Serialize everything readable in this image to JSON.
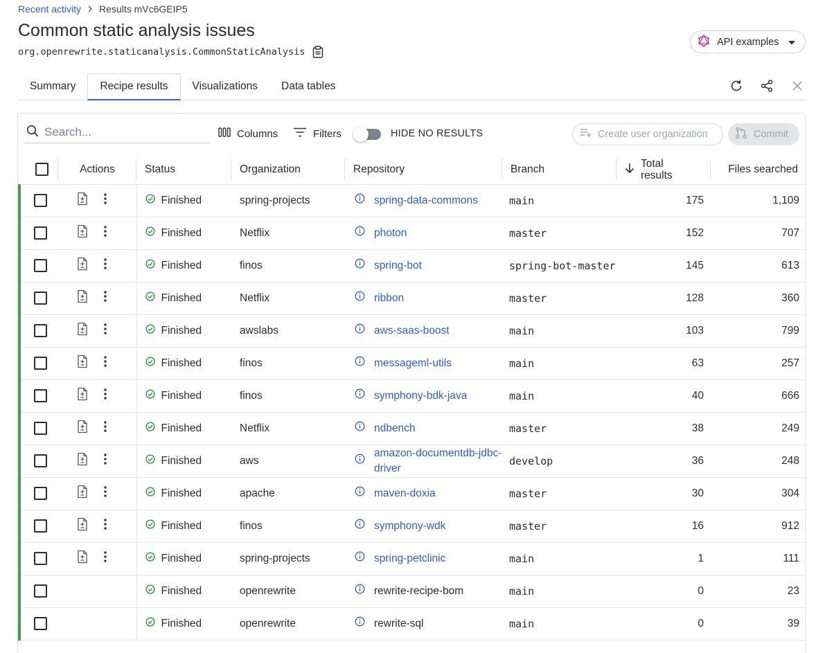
{
  "breadcrumb": {
    "parent": "Recent activity",
    "current": "Results mVc6GEIP5"
  },
  "title": "Common static analysis issues",
  "recipe_id": "org.openrewrite.staticanalysis.CommonStaticAnalysis",
  "api_button": {
    "label": "API examples"
  },
  "tabs": [
    {
      "label": "Summary"
    },
    {
      "label": "Recipe results"
    },
    {
      "label": "Visualizations"
    },
    {
      "label": "Data tables"
    }
  ],
  "toolbar": {
    "search_placeholder": "Search...",
    "columns_label": "Columns",
    "filters_label": "Filters",
    "hide_no_results_label": "HIDE NO RESULTS",
    "create_org_label": "Create user organization",
    "commit_label": "Commit"
  },
  "table": {
    "headers": {
      "actions": "Actions",
      "status": "Status",
      "organization": "Organization",
      "repository": "Repository",
      "branch": "Branch",
      "total_results": "Total results",
      "files_searched": "Files searched"
    },
    "rows": [
      {
        "status": "Finished",
        "organization": "spring-projects",
        "repository": "spring-data-commons",
        "branch": "main",
        "total": "175",
        "files": "1,109",
        "actions": true
      },
      {
        "status": "Finished",
        "organization": "Netflix",
        "repository": "photon",
        "branch": "master",
        "total": "152",
        "files": "707",
        "actions": true
      },
      {
        "status": "Finished",
        "organization": "finos",
        "repository": "spring-bot",
        "branch": "spring-bot-master",
        "total": "145",
        "files": "613",
        "actions": true
      },
      {
        "status": "Finished",
        "organization": "Netflix",
        "repository": "ribbon",
        "branch": "master",
        "total": "128",
        "files": "360",
        "actions": true
      },
      {
        "status": "Finished",
        "organization": "awslabs",
        "repository": "aws-saas-boost",
        "branch": "main",
        "total": "103",
        "files": "799",
        "actions": true
      },
      {
        "status": "Finished",
        "organization": "finos",
        "repository": "messageml-utils",
        "branch": "main",
        "total": "63",
        "files": "257",
        "actions": true
      },
      {
        "status": "Finished",
        "organization": "finos",
        "repository": "symphony-bdk-java",
        "branch": "main",
        "total": "40",
        "files": "666",
        "actions": true
      },
      {
        "status": "Finished",
        "organization": "Netflix",
        "repository": "ndbench",
        "branch": "master",
        "total": "38",
        "files": "249",
        "actions": true
      },
      {
        "status": "Finished",
        "organization": "aws",
        "repository": "amazon-documentdb-jdbc-driver",
        "branch": "develop",
        "total": "36",
        "files": "248",
        "actions": true
      },
      {
        "status": "Finished",
        "organization": "apache",
        "repository": "maven-doxia",
        "branch": "master",
        "total": "30",
        "files": "304",
        "actions": true
      },
      {
        "status": "Finished",
        "organization": "finos",
        "repository": "symphony-wdk",
        "branch": "master",
        "total": "16",
        "files": "912",
        "actions": true
      },
      {
        "status": "Finished",
        "organization": "spring-projects",
        "repository": "spring-petclinic",
        "branch": "main",
        "total": "1",
        "files": "111",
        "actions": true
      },
      {
        "status": "Finished",
        "organization": "openrewrite",
        "repository": "rewrite-recipe-bom",
        "branch": "main",
        "total": "0",
        "files": "23",
        "actions": false
      },
      {
        "status": "Finished",
        "organization": "openrewrite",
        "repository": "rewrite-sql",
        "branch": "main",
        "total": "0",
        "files": "39",
        "actions": false
      }
    ]
  },
  "colors": {
    "accent": "#3b63d6",
    "link": "#2f5bd0",
    "success": "#3f9a4a"
  }
}
